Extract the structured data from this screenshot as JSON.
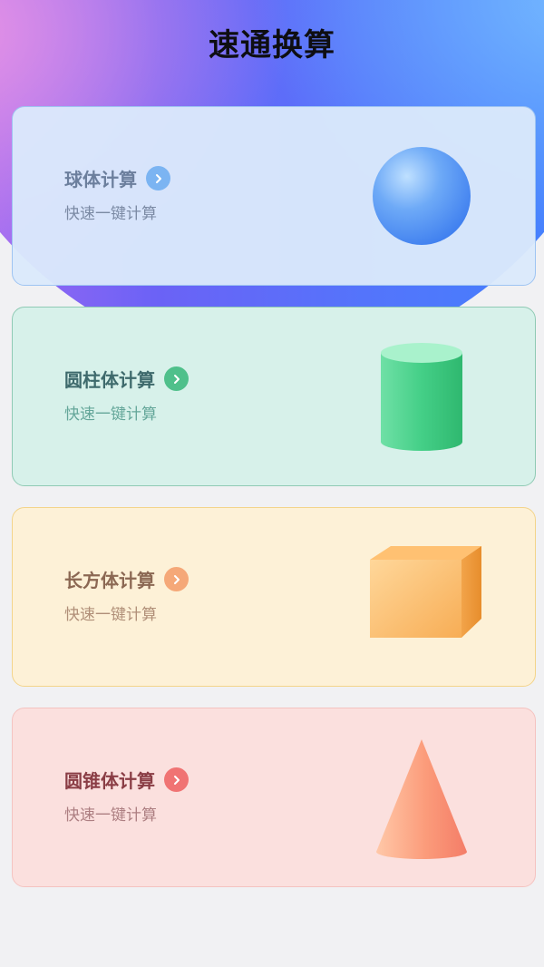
{
  "header": {
    "title": "速通换算"
  },
  "cards": [
    {
      "title": "球体计算",
      "subtitle": "快速一键计算",
      "shape": "sphere-icon"
    },
    {
      "title": "圆柱体计算",
      "subtitle": "快速一键计算",
      "shape": "cylinder-icon"
    },
    {
      "title": "长方体计算",
      "subtitle": "快速一键计算",
      "shape": "cuboid-icon"
    },
    {
      "title": "圆锥体计算",
      "subtitle": "快速一键计算",
      "shape": "cone-icon"
    }
  ],
  "colors": {
    "sphere_card": "#dbe9fb",
    "cylinder_card": "#d7f1ea",
    "cuboid_card": "#fdf1d7",
    "cone_card": "#fbe0de",
    "sphere_arrow": "#7bb4f2",
    "cylinder_arrow": "#4fc08b",
    "cuboid_arrow": "#f5a878",
    "cone_arrow": "#f07373"
  }
}
